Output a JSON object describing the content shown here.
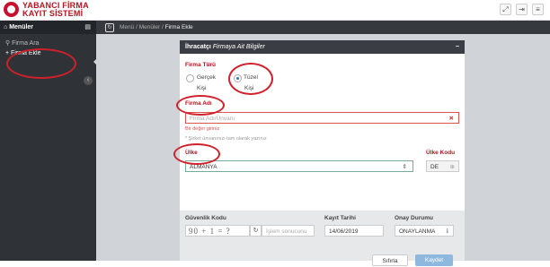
{
  "header": {
    "logo_line1": "YABANCI FİRMA",
    "logo_line2": "KAYIT SİSTEMİ",
    "buttons": [
      "expand-icon",
      "logout-icon",
      "menu-icon"
    ],
    "brand_color": "#c8102e"
  },
  "sidebar": {
    "title": "Menüler",
    "items": [
      {
        "label": "Firma Ara",
        "icon": "search-icon"
      },
      {
        "label": "Firma Ekle",
        "icon": "plus-icon"
      }
    ]
  },
  "breadcrumb": {
    "parts": [
      "Menü",
      "Menüler"
    ],
    "current": "Firma Ekle"
  },
  "panel": {
    "title_bold": "İhracatçı",
    "title_rest": "Firmaya Ait Bilgiler",
    "firma_turu": {
      "label": "Firma Türü",
      "options": [
        {
          "line1": "Gerçek",
          "line2": "Kişi",
          "selected": false
        },
        {
          "line1": "Tüzel",
          "line2": "Kişi",
          "selected": true
        }
      ]
    },
    "firma_adi": {
      "label": "Firma Adı",
      "placeholder": "Firma Adı/Ünvanı",
      "error": "Bir değer giriniz",
      "hint": "* Şirket ünvanınızı tam olarak yazınız"
    },
    "ulke": {
      "label": "Ülke",
      "value": "ALMANYA",
      "kod_label": "Ülke Kodu",
      "kod_value": "DE"
    },
    "guvenlik": {
      "label": "Güvenlik Kodu",
      "captcha": "90 + 1 = ?",
      "placeholder": "İşlem sonucunu"
    },
    "kayit_tarihi": {
      "label": "Kayıt Tarihi",
      "value": "14/06/2019"
    },
    "onay": {
      "label": "Onay Durumu",
      "value": "ONAYLANMA"
    },
    "buttons": {
      "clear": "Sıfırla",
      "save": "Kaydet"
    }
  },
  "annotation_color": "#d0202a"
}
